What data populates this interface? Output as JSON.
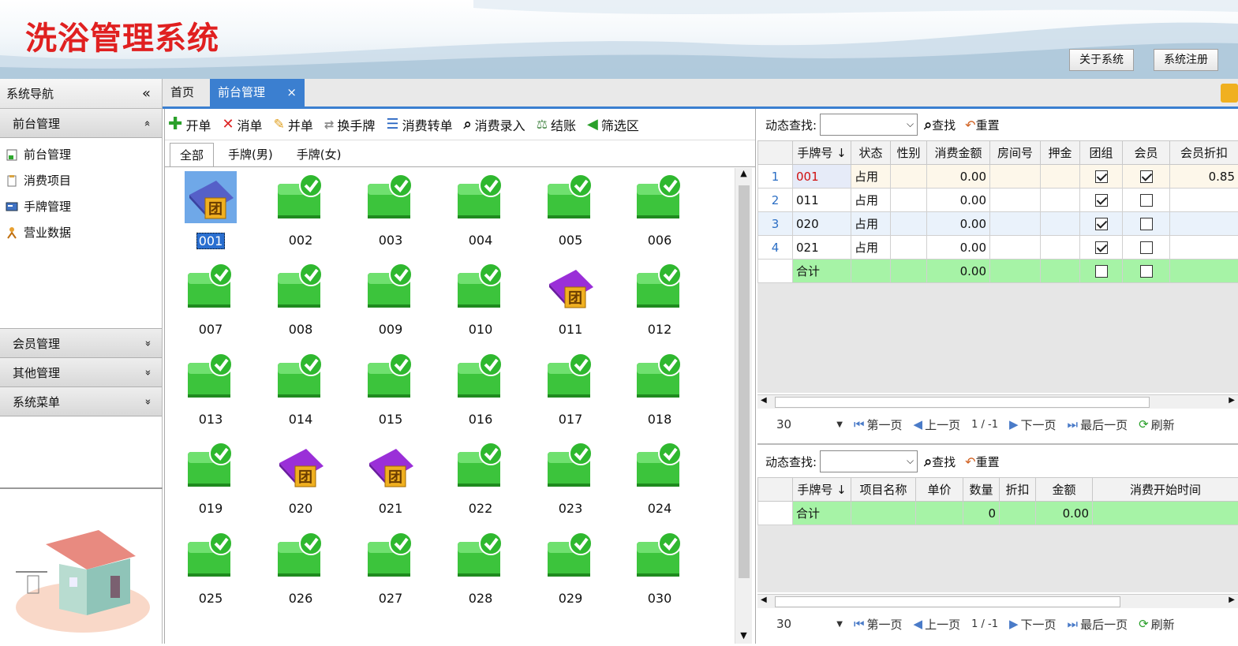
{
  "header": {
    "app_title": "洗浴管理系统",
    "about_button": "关于系统",
    "register_button": "系统注册"
  },
  "sidebar": {
    "title": "系统导航",
    "collapse_glyph": "«",
    "sections": [
      {
        "label": "前台管理",
        "glyph": "»",
        "expanded": true
      },
      {
        "label": "会员管理",
        "glyph": "»"
      },
      {
        "label": "其他管理",
        "glyph": "»"
      },
      {
        "label": "系统菜单",
        "glyph": "»"
      }
    ],
    "items": [
      {
        "label": "前台管理",
        "icon": "front-desk-icon"
      },
      {
        "label": "消费项目",
        "icon": "consume-item-icon"
      },
      {
        "label": "手牌管理",
        "icon": "card-icon"
      },
      {
        "label": "营业数据",
        "icon": "business-data-icon"
      }
    ]
  },
  "tabs": {
    "home": "首页",
    "front": "前台管理",
    "close_glyph": "×"
  },
  "toolbar": {
    "open": "开单",
    "cancel": "消单",
    "merge": "并单",
    "swap": "换手牌",
    "transfer": "消费转单",
    "entry": "消费录入",
    "checkout": "结账",
    "filter": "筛选区"
  },
  "subtabs": {
    "all": "全部",
    "male": "手牌(男)",
    "female": "手牌(女)"
  },
  "cards": [
    {
      "no": "001",
      "status": "group",
      "selected": true
    },
    {
      "no": "002"
    },
    {
      "no": "003"
    },
    {
      "no": "004"
    },
    {
      "no": "005"
    },
    {
      "no": "006"
    },
    {
      "no": "007"
    },
    {
      "no": "008"
    },
    {
      "no": "009"
    },
    {
      "no": "010"
    },
    {
      "no": "011",
      "status": "group"
    },
    {
      "no": "012"
    },
    {
      "no": "013"
    },
    {
      "no": "014"
    },
    {
      "no": "015"
    },
    {
      "no": "016"
    },
    {
      "no": "017"
    },
    {
      "no": "018"
    },
    {
      "no": "019"
    },
    {
      "no": "020",
      "status": "group"
    },
    {
      "no": "021",
      "status": "group"
    },
    {
      "no": "022"
    },
    {
      "no": "023"
    },
    {
      "no": "024"
    },
    {
      "no": "025"
    },
    {
      "no": "026"
    },
    {
      "no": "027"
    },
    {
      "no": "028"
    },
    {
      "no": "029"
    },
    {
      "no": "030"
    }
  ],
  "tile_badge": "团",
  "search1": {
    "label": "动态查找:",
    "find": "查找",
    "reset": "重置"
  },
  "table1": {
    "headers": [
      "手牌号 ↓",
      "状态",
      "性别",
      "消费金额",
      "房间号",
      "押金",
      "团组",
      "会员",
      "会员折扣"
    ],
    "rows": [
      {
        "idx": "1",
        "no": "001",
        "status": "占用",
        "gender": "",
        "amount": "0.00",
        "room": "",
        "deposit": "",
        "group": true,
        "member": true,
        "discount": "0.85"
      },
      {
        "idx": "2",
        "no": "011",
        "status": "占用",
        "gender": "",
        "amount": "0.00",
        "room": "",
        "deposit": "",
        "group": true,
        "member": false,
        "discount": ""
      },
      {
        "idx": "3",
        "no": "020",
        "status": "占用",
        "gender": "",
        "amount": "0.00",
        "room": "",
        "deposit": "",
        "group": true,
        "member": false,
        "discount": ""
      },
      {
        "idx": "4",
        "no": "021",
        "status": "占用",
        "gender": "",
        "amount": "0.00",
        "room": "",
        "deposit": "",
        "group": true,
        "member": false,
        "discount": ""
      }
    ],
    "total_label": "合计",
    "total_amount": "0.00"
  },
  "pager1": {
    "size": "30",
    "first": "第一页",
    "prev": "上一页",
    "page": "1 / -1",
    "next": "下一页",
    "last": "最后一页",
    "refresh": "刷新"
  },
  "search2": {
    "label": "动态查找:",
    "find": "查找",
    "reset": "重置"
  },
  "table2": {
    "headers": [
      "手牌号 ↓",
      "项目名称",
      "单价",
      "数量",
      "折扣",
      "金额",
      "消费开始时间"
    ],
    "total_label": "合计",
    "total_qty": "0",
    "total_amount": "0.00"
  },
  "pager2": {
    "size": "30",
    "first": "第一页",
    "prev": "上一页",
    "page": "1 / -1",
    "next": "下一页",
    "last": "最后一页",
    "refresh": "刷新"
  },
  "colors": {
    "accent": "#3b7fd0",
    "title_red": "#e02020",
    "total_green": "#a6f3a6",
    "card_green": "#3cc43c",
    "group_purple": "#8a2be2"
  }
}
